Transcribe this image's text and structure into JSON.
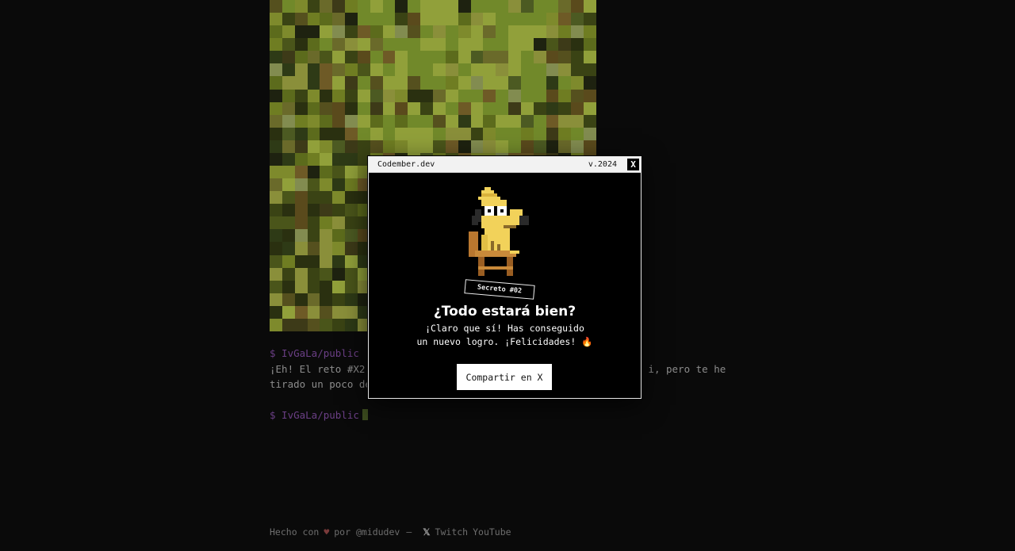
{
  "terminal": {
    "prompt_1": "$ IvGaLa/public",
    "line_1_start": "¡Eh! El reto #X2",
    "line_1_end": "i, pero te he",
    "line_2_start": "tirado un poco de",
    "prompt_2": "$ IvGaLa/public"
  },
  "modal": {
    "title": "Codember.dev",
    "version": "v.2024",
    "close_label": "X",
    "badge": "Secreto #02",
    "heading": "¿Todo estará bien?",
    "message_line_1": "¡Claro que sí! Has conseguido",
    "message_line_2": "un nuevo logro. ¡Felicidades! 🔥",
    "share_label": "Compartir en X"
  },
  "footer": {
    "made_with": "Hecho con",
    "heart": "♥",
    "by": "por @midudev",
    "separator": "–",
    "x_icon": "𝕏",
    "twitch": "Twitch",
    "youtube": "YouTube"
  },
  "colors": {
    "background": "#0a0a0a",
    "prompt": "#6b3f86",
    "modal_bg": "#000000",
    "modal_bar": "#f2f2f2",
    "dog_yellow": "#f2d25a"
  },
  "icons": {
    "close": "close-icon",
    "fire": "fire-icon",
    "heart": "heart-icon",
    "x_logo": "x-logo-icon"
  }
}
